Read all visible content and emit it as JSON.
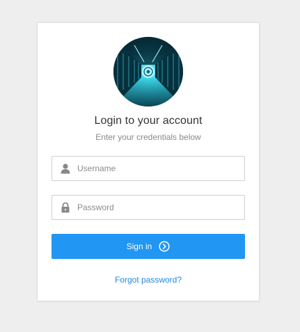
{
  "login": {
    "title": "Login to your account",
    "subtitle": "Enter your credentials below",
    "username": {
      "placeholder": "Username",
      "value": ""
    },
    "password": {
      "placeholder": "Password",
      "value": ""
    },
    "signin_label": "Sign in",
    "forgot_label": "Forgot password?"
  },
  "colors": {
    "background": "#eeeeee",
    "card": "#ffffff",
    "accent": "#2196f3",
    "link": "#1e88e5",
    "title_text": "#333333",
    "muted_text": "#8a8a8a"
  },
  "icons": {
    "avatar": "server-room-image",
    "username": "user-icon",
    "password": "lock-icon",
    "signin": "chevron-right-circle-icon"
  }
}
